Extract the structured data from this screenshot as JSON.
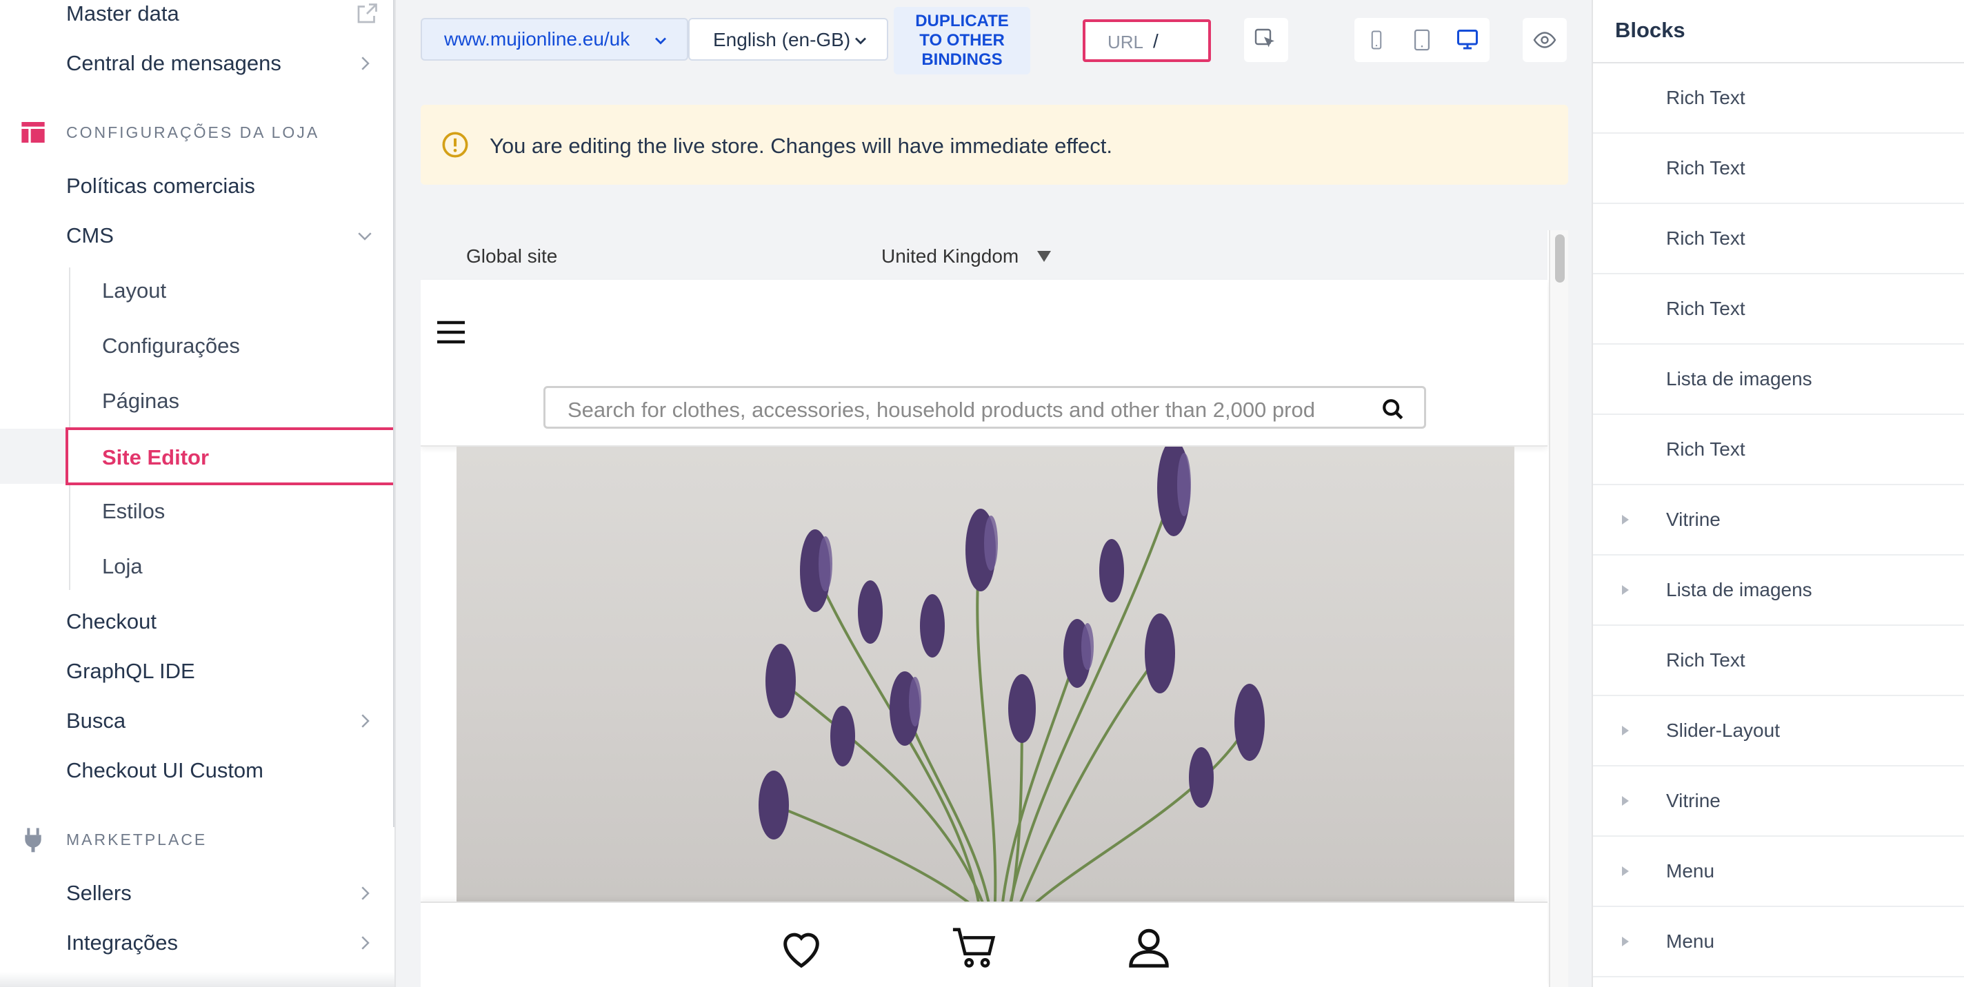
{
  "sidebar": {
    "items_top": [
      {
        "label": "Master data"
      },
      {
        "label": "Central de mensagens"
      }
    ],
    "store_section_title": "CONFIGURAÇÕES DA LOJA",
    "store_items": [
      {
        "label": "Políticas comerciais"
      },
      {
        "label": "CMS"
      }
    ],
    "cms_children": [
      {
        "label": "Layout"
      },
      {
        "label": "Configurações"
      },
      {
        "label": "Páginas"
      },
      {
        "label": "Site Editor"
      },
      {
        "label": "Estilos"
      },
      {
        "label": "Loja"
      }
    ],
    "store_items_after": [
      {
        "label": "Checkout"
      },
      {
        "label": "GraphQL IDE"
      },
      {
        "label": "Busca"
      },
      {
        "label": "Checkout UI Custom"
      }
    ],
    "marketplace_title": "MARKETPLACE",
    "marketplace_items": [
      {
        "label": "Sellers"
      },
      {
        "label": "Integrações"
      }
    ],
    "accent_color": "#e2356b"
  },
  "toolbar": {
    "binding": "www.mujionline.eu/uk",
    "locale": "English (en-GB)",
    "duplicate_label": "DUPLICATE\nTO OTHER\nBINDINGS",
    "url_prefix": "URL",
    "url_value": "/",
    "icons": [
      "inspect-cursor-icon",
      "mobile-icon",
      "tablet-icon",
      "desktop-icon",
      "eye-icon"
    ]
  },
  "warning": {
    "text": "You are editing the live store. Changes will have immediate effect."
  },
  "preview": {
    "global_site": "Global site",
    "country": "United Kingdom",
    "search_placeholder": "Search for clothes, accessories, household products and other than 2,000 prod"
  },
  "blocks": {
    "title": "Blocks",
    "items": [
      {
        "label": "Rich Text",
        "expandable": false
      },
      {
        "label": "Rich Text",
        "expandable": false
      },
      {
        "label": "Rich Text",
        "expandable": false
      },
      {
        "label": "Rich Text",
        "expandable": false
      },
      {
        "label": "Lista de imagens",
        "expandable": false
      },
      {
        "label": "Rich Text",
        "expandable": false
      },
      {
        "label": "Vitrine",
        "expandable": true
      },
      {
        "label": "Lista de imagens",
        "expandable": true
      },
      {
        "label": "Rich Text",
        "expandable": false
      },
      {
        "label": "Slider-Layout",
        "expandable": true
      },
      {
        "label": "Vitrine",
        "expandable": true
      },
      {
        "label": "Menu",
        "expandable": true
      },
      {
        "label": "Menu",
        "expandable": true
      }
    ]
  }
}
